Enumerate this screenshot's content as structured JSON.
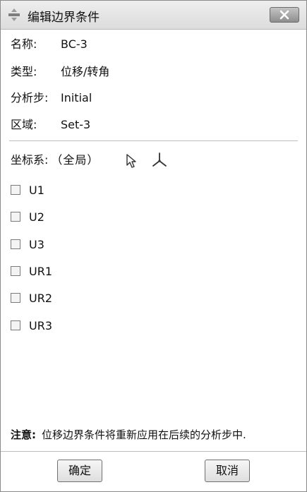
{
  "window": {
    "title": "编辑边界条件"
  },
  "fields": {
    "name": {
      "label": "名称:",
      "value": "BC-3"
    },
    "type": {
      "label": "类型:",
      "value": "位移/转角"
    },
    "step": {
      "label": "分析步:",
      "value": "Initial"
    },
    "region": {
      "label": "区域:",
      "value": "Set-3"
    }
  },
  "coordinate_system": {
    "label": "坐标系:",
    "value": "（全局）"
  },
  "dofs": [
    {
      "label": "U1",
      "checked": false
    },
    {
      "label": "U2",
      "checked": false
    },
    {
      "label": "U3",
      "checked": false
    },
    {
      "label": "UR1",
      "checked": false
    },
    {
      "label": "UR2",
      "checked": false
    },
    {
      "label": "UR3",
      "checked": false
    }
  ],
  "note": {
    "prefix": "注意:",
    "text": "位移边界条件将重新应用在后续的分析步中."
  },
  "buttons": {
    "ok": "确定",
    "cancel": "取消"
  },
  "icons": {
    "title": "boundary-condition-icon",
    "close": "close-icon",
    "select": "arrow-select-icon",
    "csys": "csys-axis-icon"
  }
}
